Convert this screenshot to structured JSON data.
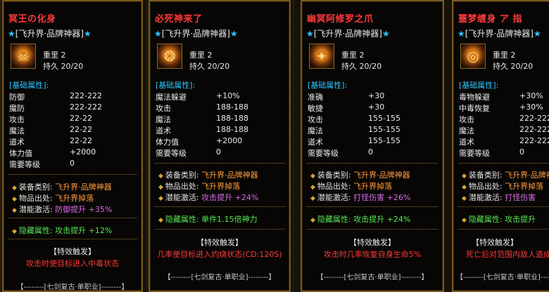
{
  "panels": [
    {
      "title": "冥王の化身",
      "rank": "[飞升界·品牌神器]",
      "icon": "helmet-icon",
      "weight": "重里 2",
      "durability": "持久 20/20",
      "section_label": "[基础属性]:",
      "stats": [
        {
          "k": "防御",
          "v": "222-222"
        },
        {
          "k": "魔防",
          "v": "222-222"
        },
        {
          "k": "攻击",
          "v": "22-22"
        },
        {
          "k": "魔法",
          "v": "22-22"
        },
        {
          "k": "道术",
          "v": "22-22"
        },
        {
          "k": "体力值",
          "v": "+2000"
        },
        {
          "k": "需要等级",
          "v": "0"
        }
      ],
      "info": [
        {
          "k": "装备类别:",
          "v": "飞升界·品牌神器"
        },
        {
          "k": "物品出处:",
          "v": "飞升界掉落"
        },
        {
          "k": "潜能激活:",
          "v": "防御提升 +35%"
        }
      ],
      "hidden": "隐藏属性: 攻击提升 +12%",
      "trigger": "【特效触发】",
      "effect": "攻击时使目标进入中毒状态",
      "footer": "【--------[七剑复古·单职业]--------】"
    },
    {
      "title": "必死神来了",
      "rank": "[飞升界·品牌神器]",
      "icon": "necklace-icon",
      "weight": "重里 2",
      "durability": "持久 20/20",
      "section_label": "[基础属性]:",
      "stats": [
        {
          "k": "魔法躲避",
          "v": "+10%"
        },
        {
          "k": "攻击",
          "v": "188-188"
        },
        {
          "k": "魔法",
          "v": "188-188"
        },
        {
          "k": "道术",
          "v": "188-188"
        },
        {
          "k": "体力值",
          "v": "+2000"
        },
        {
          "k": "需要等级",
          "v": "0"
        }
      ],
      "info": [
        {
          "k": "装备类别:",
          "v": "飞升界·品牌神器"
        },
        {
          "k": "物品出处:",
          "v": "飞升界掉落"
        },
        {
          "k": "潜能激活:",
          "v": "攻击提升 +24%"
        }
      ],
      "hidden": "隐藏属性: 单件1.15倍神力",
      "trigger": "【特效触发】",
      "effect": "几率使目标进入灼烧状态(CD:120S)",
      "footer": "【--------[七剑复古·单职业]--------】"
    },
    {
      "title": "幽冥阿修罗之爪",
      "rank": "[飞升界·品牌神器]",
      "icon": "claw-bracelet-icon",
      "weight": "重里 2",
      "durability": "持久 20/20",
      "section_label": "[基础属性]:",
      "stats": [
        {
          "k": "准确",
          "v": "+30"
        },
        {
          "k": "敏捷",
          "v": "+30"
        },
        {
          "k": "攻击",
          "v": "155-155"
        },
        {
          "k": "魔法",
          "v": "155-155"
        },
        {
          "k": "道术",
          "v": "155-155"
        },
        {
          "k": "需要等级",
          "v": "0"
        }
      ],
      "info": [
        {
          "k": "装备类别:",
          "v": "飞升界·品牌神器"
        },
        {
          "k": "物品出处:",
          "v": "飞升界掉落"
        },
        {
          "k": "潜能激活:",
          "v": "打怪伤害 +26%"
        }
      ],
      "hidden": "隐藏属性: 攻击提升 +24%",
      "trigger": "【特效触发】",
      "effect": "攻击时几率恢复自身生命5%",
      "footer": "【--------[七剑复古·单职业]--------】"
    },
    {
      "title": "噩梦缠身 ア 指",
      "rank": "[飞升界·品牌神器]",
      "icon": "ring-icon",
      "weight": "重里 2",
      "durability": "持久 20/20",
      "section_label": "[基础属性]:",
      "stats": [
        {
          "k": "毒物躲避",
          "v": "+30%"
        },
        {
          "k": "中毒恢复",
          "v": "+30%"
        },
        {
          "k": "攻击",
          "v": "222-222"
        },
        {
          "k": "魔法",
          "v": "222-222"
        },
        {
          "k": "道术",
          "v": "222-222"
        },
        {
          "k": "需要等级",
          "v": "0"
        }
      ],
      "info": [
        {
          "k": "装备类别:",
          "v": "飞升界·品牌神器"
        },
        {
          "k": "物品出处:",
          "v": "飞升界掉落"
        },
        {
          "k": "潜能激活:",
          "v": "打怪伤害"
        }
      ],
      "hidden": "隐藏属性: 攻击提升",
      "trigger": "【特效触发】",
      "effect": "死亡后对范围内敌人造成",
      "footer": "【--------[七剑复古·单职业]--------】"
    }
  ],
  "colors": {
    "title": "#ff3a3a",
    "star": "#2ec7ff",
    "section": "#2ec7ff",
    "info_value": "#ff9a3c",
    "potential": "#d96ce8",
    "hidden": "#58e858",
    "border": "#7a5a1d"
  }
}
